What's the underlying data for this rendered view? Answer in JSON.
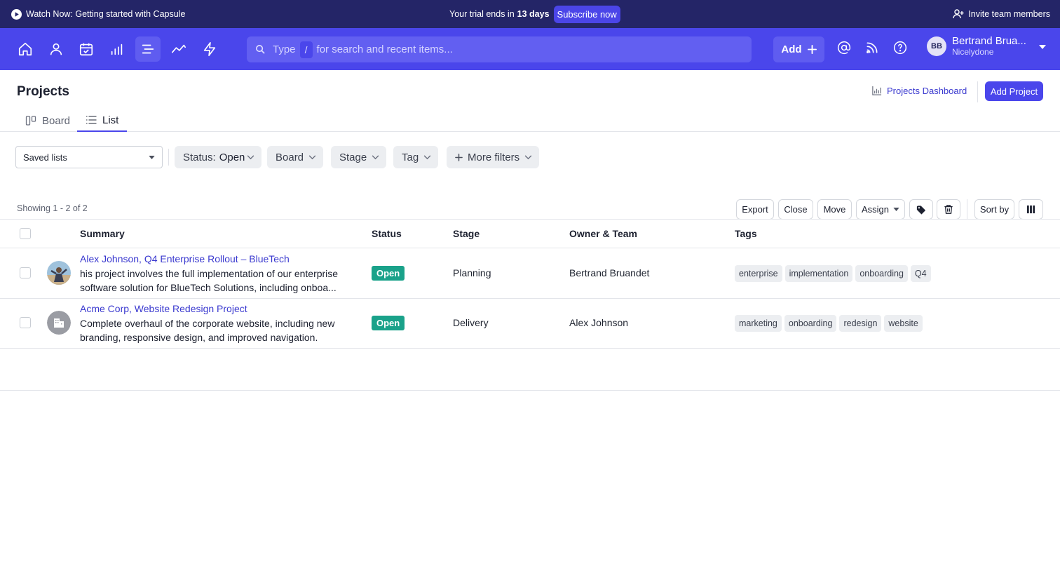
{
  "announcement": {
    "watch_label": "Watch Now: Getting started with Capsule",
    "trial_prefix": "Your trial ends in",
    "trial_days": "13 days",
    "subscribe_label": "Subscribe now",
    "invite_label": "Invite team members"
  },
  "nav": {
    "icons": [
      "home-icon",
      "person-icon",
      "calendar-icon",
      "bar-chart-icon",
      "projects-icon",
      "trend-icon",
      "lightning-icon"
    ],
    "active": "projects-icon",
    "search_type": "Type",
    "search_slash": "/",
    "search_placeholder": "for search and recent items...",
    "add_label": "Add",
    "user_initials": "BB",
    "user_name": "Bertrand Brua...",
    "user_org": "Nicelydone"
  },
  "page": {
    "title": "Projects",
    "dashboard_label": "Projects Dashboard",
    "add_project_label": "Add Project",
    "tabs": [
      {
        "label": "Board",
        "active": false
      },
      {
        "label": "List",
        "active": true
      }
    ]
  },
  "filters": {
    "saved_lists": "Saved lists",
    "status_label": "Status:",
    "status_value": "Open",
    "board": "Board",
    "stage": "Stage",
    "tag": "Tag",
    "more": "More filters"
  },
  "toolbar": {
    "showing": "Showing 1 - 2 of 2",
    "export": "Export",
    "close": "Close",
    "move": "Move",
    "assign": "Assign",
    "sort_by": "Sort by"
  },
  "table": {
    "columns": [
      "Summary",
      "Status",
      "Stage",
      "Owner & Team",
      "Tags"
    ],
    "rows": [
      {
        "title": "Alex Johnson, Q4 Enterprise Rollout – BlueTech",
        "description": "his project involves the full implementation of our enterprise software solution for BlueTech Solutions, including onboa...",
        "status": "Open",
        "stage": "Planning",
        "owner": "Bertrand Bruandet",
        "tags": [
          "enterprise",
          "implementation",
          "onboarding",
          "Q4"
        ]
      },
      {
        "title": "Acme Corp, Website Redesign Project",
        "description": "Complete overhaul of the corporate website, including new branding, responsive design, and improved navigation.",
        "status": "Open",
        "stage": "Delivery",
        "owner": "Alex Johnson",
        "tags": [
          "marketing",
          "onboarding",
          "redesign",
          "website"
        ]
      }
    ]
  },
  "colors": {
    "nav_bg": "#4a46eb",
    "announce_bg": "#242567",
    "link": "#3a39cf",
    "status_open": "#1aa28a"
  }
}
